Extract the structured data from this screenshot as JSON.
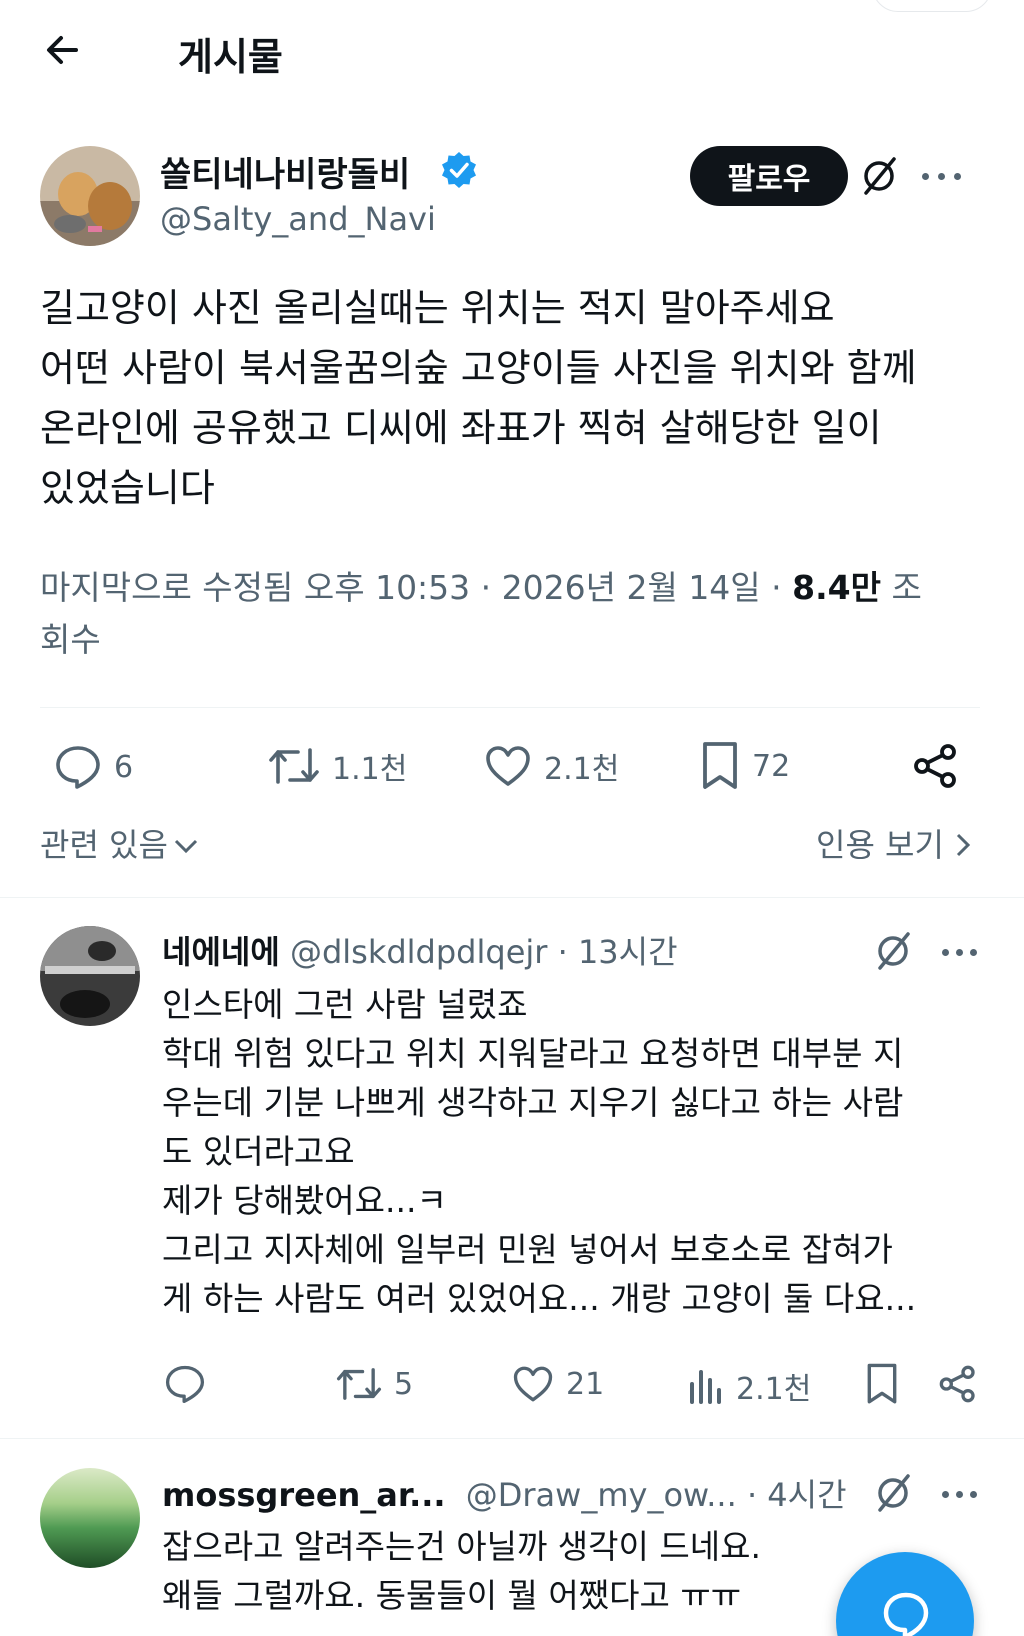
{
  "header": {
    "title": "게시물"
  },
  "main_post": {
    "author_name": "쏠티네나비랑돌비",
    "author_handle": "@Salty_and_Navi",
    "follow_label": "팔로우",
    "text_lines": [
      "길고양이 사진 올리실때는 위치는 적지 말아주세요",
      "어떤 사람이 북서울꿈의숲 고양이들 사진을 위치와 함께",
      "온라인에 공유했고 디씨에 좌표가 찍혀 살해당한 일이",
      "있었습니다"
    ],
    "meta_prefix": "마지막으로 수정됨 오후 10:53 · 2026년 2월 14일 · ",
    "views_value": "8.4만",
    "views_suffix_part1": " 조",
    "views_suffix_part2": "회수",
    "stats": {
      "replies": "6",
      "reposts": "1.1천",
      "likes": "2.1천",
      "bookmarks": "72"
    },
    "related_label": "관련 있음",
    "quotes_label": "인용 보기"
  },
  "replies": [
    {
      "name": "네에네에",
      "handle": "@dlskdldpdlqejr",
      "time": "· 13시간",
      "text_lines": [
        "인스타에 그런 사람 널렸죠",
        "학대 위험 있다고 위치 지워달라고 요청하면 대부분 지",
        "우는데 기분 나쁘게 생각하고 지우기 싫다고 하는 사람",
        "도 있더라고요",
        "제가 당해봤어요...ㅋ",
        "그리고 지자체에 일부러 민원 넣어서 보호소로 잡혀가",
        "게 하는 사람도 여러 있었어요... 개랑 고양이 둘 다요..."
      ],
      "stats": {
        "reposts": "5",
        "likes": "21",
        "views": "2.1천"
      }
    },
    {
      "name": "mossgreen_ar...",
      "handle": "@Draw_my_ow...",
      "time": "· 4시간",
      "text_lines": [
        "잡으라고 알려주는건 아닐까 생각이 드네요.",
        "왜들 그럴까요. 동물들이 뭘 어쨌다고 ㅠㅠ"
      ]
    }
  ],
  "colors": {
    "accent": "#1d9bf0",
    "secondary_text": "#536471",
    "primary_text": "#0f1419"
  },
  "icons": [
    "back-arrow-icon",
    "verified-badge-icon",
    "grok-icon",
    "more-icon",
    "reply-icon",
    "repost-icon",
    "like-icon",
    "bookmark-icon",
    "share-icon",
    "views-icon",
    "compose-icon"
  ]
}
